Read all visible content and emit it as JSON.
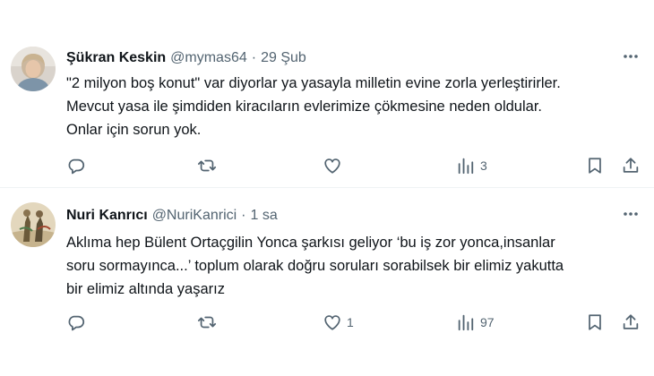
{
  "tweets": [
    {
      "display_name": "Şükran Keskin",
      "handle": "@mymas64",
      "separator": "·",
      "time": "29 Şub",
      "text_lines": [
        "\"2 milyon boş konut\" var diyorlar ya yasayla milletin evine zorla yerleştirirler.",
        "Mevcut yasa ile şimdiden kiracıların evlerimize çökmesine neden oldular.",
        "Onlar için sorun yok."
      ],
      "replies": "",
      "retweets": "",
      "likes": "",
      "views": "3"
    },
    {
      "display_name": "Nuri Kanrıcı",
      "handle": "@NuriKanrici",
      "separator": "·",
      "time": "1 sa",
      "text_lines": [
        "Aklıma hep Bülent Ortaçgilin Yonca şarkısı geliyor ‘bu iş zor yonca,insanlar",
        "soru sormayınca...’ toplum olarak doğru soruları sorabilsek bir elimiz yakutta",
        "bir elimiz altında yaşarız"
      ],
      "replies": "",
      "retweets": "",
      "likes": "1",
      "views": "97"
    }
  ],
  "colors": {
    "text": "#0f1419",
    "secondary": "#536471",
    "divider": "#eff3f4"
  },
  "icons": [
    "more-icon",
    "reply-icon",
    "retweet-icon",
    "like-icon",
    "views-icon",
    "bookmark-icon",
    "share-icon"
  ]
}
